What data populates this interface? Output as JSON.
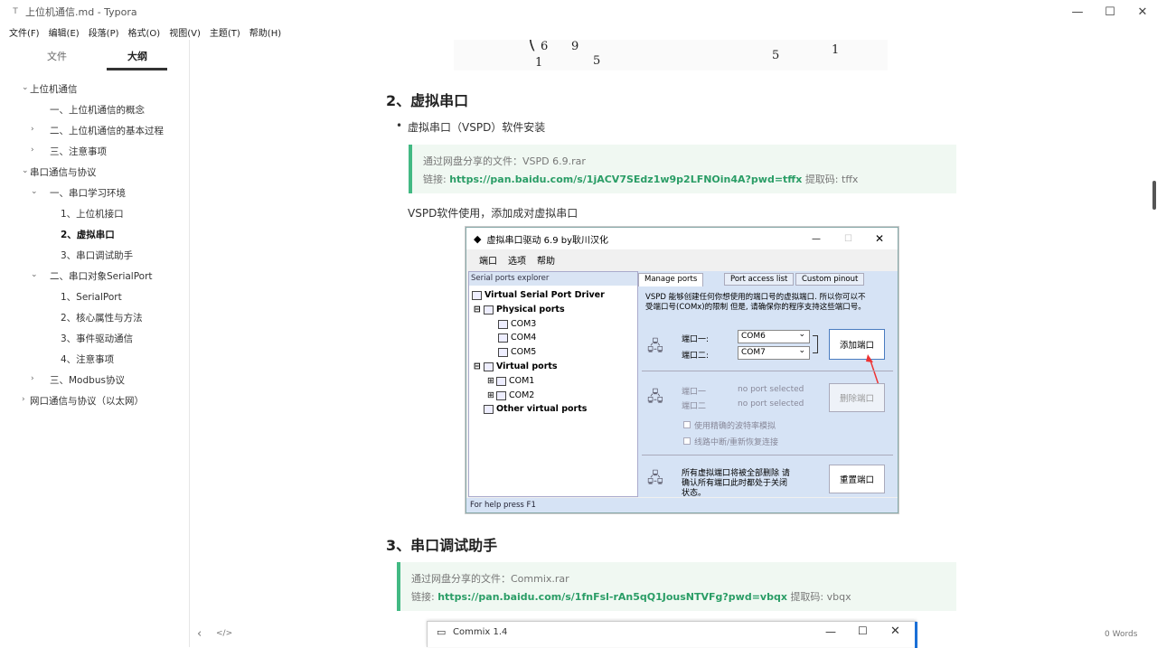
{
  "window": {
    "title": "上位机通信.md - Typora",
    "minimize": "—",
    "maximize": "☐",
    "close": "✕"
  },
  "menu": [
    "文件(F)",
    "编辑(E)",
    "段落(P)",
    "格式(O)",
    "视图(V)",
    "主题(T)",
    "帮助(H)"
  ],
  "sidebar": {
    "tabs": [
      "文件",
      "大纲"
    ],
    "outline": [
      {
        "label": "上位机通信",
        "chev": "⌄"
      },
      {
        "label": "一、上位机通信的概念",
        "chev": ""
      },
      {
        "label": "二、上位机通信的基本过程",
        "chev": "›"
      },
      {
        "label": "三、注意事项",
        "chev": "›"
      },
      {
        "label": "串口通信与协议",
        "chev": "⌄"
      },
      {
        "label": "一、串口学习环境",
        "chev": "⌄"
      },
      {
        "label": "1、上位机接口",
        "chev": ""
      },
      {
        "label": "2、虚拟串口",
        "chev": ""
      },
      {
        "label": "3、串口调试助手",
        "chev": ""
      },
      {
        "label": "二、串口对象SerialPort",
        "chev": "⌄"
      },
      {
        "label": "1、SerialPort",
        "chev": ""
      },
      {
        "label": "2、核心属性与方法",
        "chev": ""
      },
      {
        "label": "3、事件驱动通信",
        "chev": ""
      },
      {
        "label": "4、注意事项",
        "chev": ""
      },
      {
        "label": "三、Modbus协议",
        "chev": "›"
      },
      {
        "label": "网口通信与协议（以太网）",
        "chev": "›"
      }
    ]
  },
  "status": {
    "back": "‹",
    "source": "</>",
    "words": "0 Words"
  },
  "doc": {
    "math": [
      "6",
      "9",
      "1",
      "5",
      "5",
      "1"
    ],
    "h_virtual": "2、虚拟串口",
    "bullet": "虚拟串口（VSPD）软件安装",
    "bq1_line1": "通过网盘分享的文件：VSPD 6.9.rar",
    "bq1_prefix": "链接:",
    "bq1_link": "https://pan.baidu.com/s/1jACV7SEdz1w9p2LFNOin4A?pwd=tffx",
    "bq1_suffix": "提取码: tffx",
    "para": "VSPD软件使用，添加成对虚拟串口",
    "h_debug": "3、串口调试助手",
    "bq2_line1": "通过网盘分享的文件：Commix.rar",
    "bq2_prefix": "链接:",
    "bq2_link": "https://pan.baidu.com/s/1fnFsl-rAn5qQ1JousNTVFg?pwd=vbqx",
    "bq2_suffix": "提取码: vbqx"
  },
  "vspd": {
    "title": "虚拟串口驱动 6.9 by耿川汉化",
    "menu": [
      "端口",
      "选项",
      "帮助"
    ],
    "explorer": "Serial ports explorer",
    "tree": {
      "root": "Virtual Serial Port Driver",
      "physical": "Physical ports",
      "com3": "COM3",
      "com4": "COM4",
      "com5": "COM5",
      "virtual": "Virtual ports",
      "com1": "COM1",
      "com2": "COM2",
      "other": "Other virtual ports"
    },
    "tabs": [
      "Manage ports",
      "Port access list",
      "Custom pinout"
    ],
    "desc1": "VSPD 能够创建任何你想使用的端口号的虚拟端口. 所以你可以不",
    "desc2": "受端口号(COMx)的限制 但是, 请确保你的程序支持这些端口号。",
    "port1_label": "端口一:",
    "port2_label": "端口二:",
    "port1_value": "COM6",
    "port2_value": "COM7",
    "add_button": "添加端口",
    "del_port1": "端口一",
    "del_port2": "端口二",
    "no_port": "no port selected",
    "del_button": "删除端口",
    "opt1": "使用精确的波特率模拟",
    "opt2": "线路中断/重新恢复连接",
    "reset1": "所有虚拟端口将被全部删除 请",
    "reset2": "确认所有端口此时都处于关闭",
    "reset3": "状态。",
    "reset_button": "重置端口",
    "status": "For help press F1"
  },
  "commix": {
    "title": "Commix 1.4"
  },
  "colors": {
    "accent": "#42b983",
    "link": "#2a9d66",
    "quote_bg": "#f0f8f2"
  }
}
